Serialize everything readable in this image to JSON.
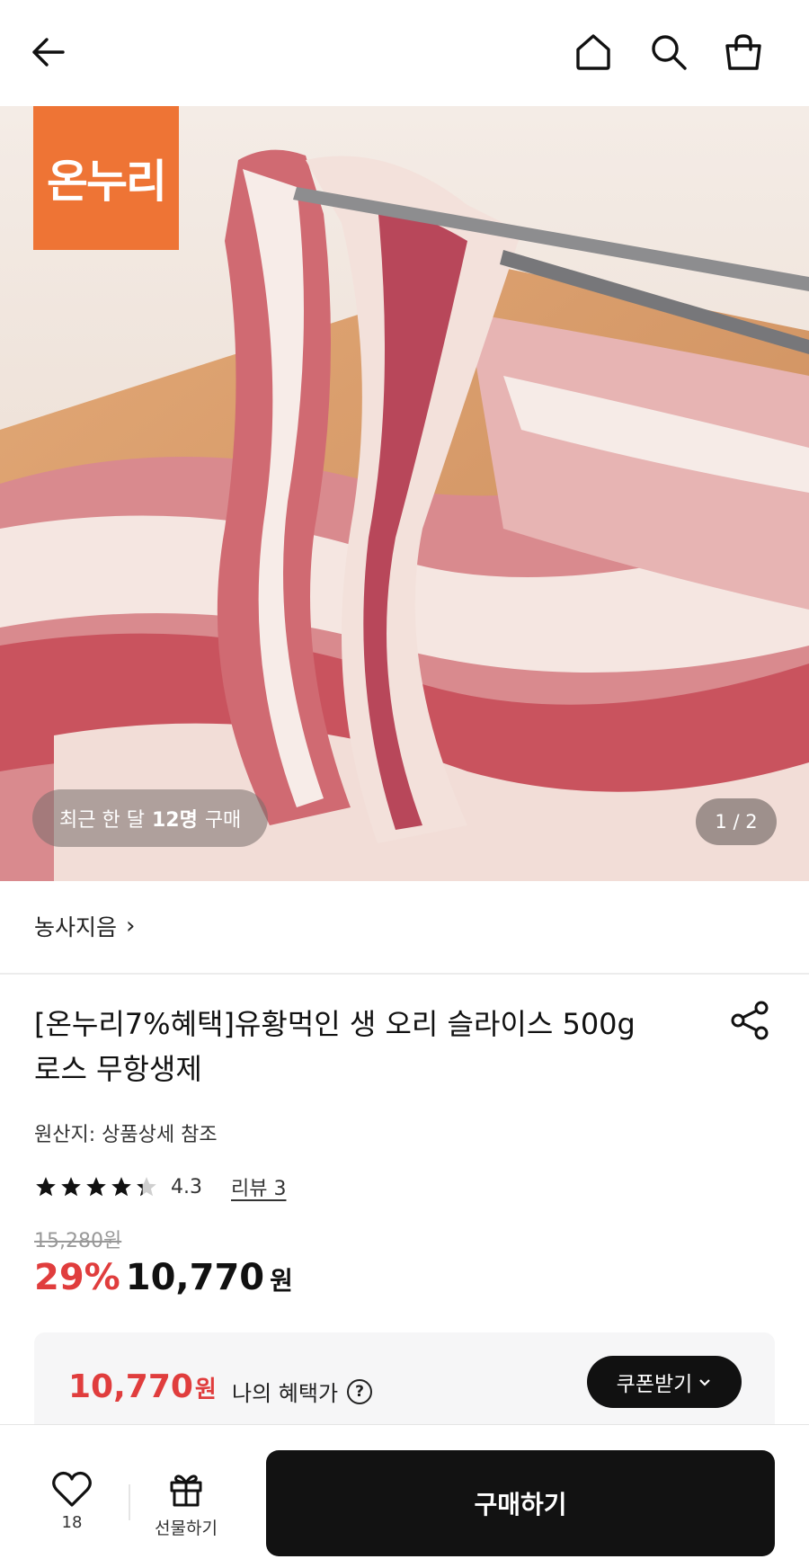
{
  "topbar": {
    "back_icon": "arrow-left-icon",
    "home_icon": "home-icon",
    "search_icon": "search-icon",
    "cart_icon": "shopping-bag-icon"
  },
  "gallery": {
    "brand_logo_text": "온누리",
    "recent_buyers_prefix": "최근 한 달",
    "recent_buyers_count": "12명",
    "recent_buyers_suffix": "구매",
    "page_indicator": "1 / 2"
  },
  "seller": {
    "name": "농사지음",
    "chevron": "›"
  },
  "product": {
    "title": "[온누리7%혜택]유황먹인 생 오리 슬라이스 500g 로스 무항생제",
    "origin": "원산지: 상품상세 참조",
    "rating": "4.3",
    "rating_value": 4.3,
    "rating_max": 5,
    "reviews": "리뷰 3",
    "original_price": "15,280원",
    "discount": "29%",
    "price": "10,770",
    "price_unit": "원"
  },
  "benefit": {
    "price": "10,770",
    "unit": "원",
    "label": "나의 혜택가",
    "help": "?",
    "coupon_button": "쿠폰받기"
  },
  "bottom": {
    "like_count": "18",
    "gift_label": "선물하기",
    "buy_label": "구매하기"
  },
  "colors": {
    "accent_red": "#e03d3d",
    "brand_orange": "#ee7435",
    "dark": "#121212"
  }
}
